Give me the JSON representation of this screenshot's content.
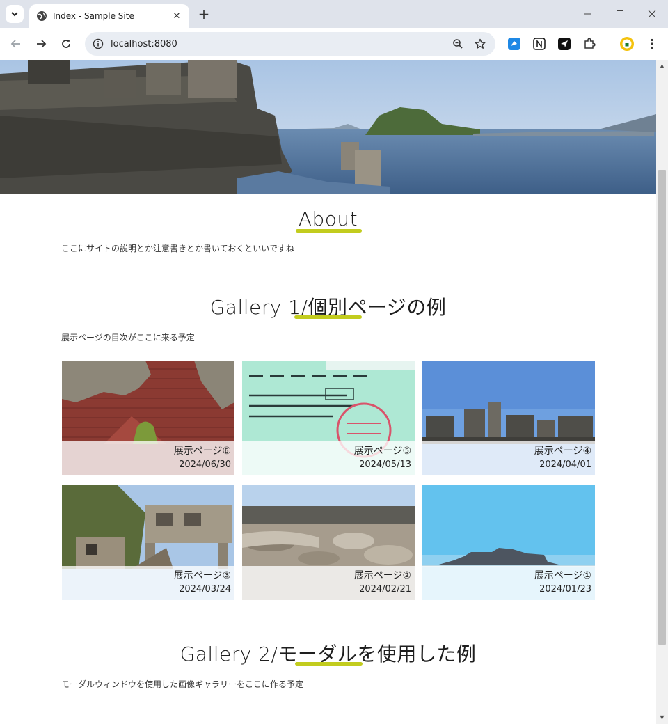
{
  "browser": {
    "tab_title": "Index - Sample Site",
    "url": "localhost:8080"
  },
  "about": {
    "title": "About",
    "text": "ここにサイトの説明とか注意書きとか書いておくといいですね"
  },
  "gallery1": {
    "title": "Gallery 1/個別ページの例",
    "text": "展示ページの目次がここに来る予定",
    "items": [
      {
        "title": "展示ページ⑥",
        "date": "2024/06/30"
      },
      {
        "title": "展示ページ⑤",
        "date": "2024/05/13"
      },
      {
        "title": "展示ページ④",
        "date": "2024/04/01"
      },
      {
        "title": "展示ページ③",
        "date": "2024/03/24"
      },
      {
        "title": "展示ページ②",
        "date": "2024/02/21"
      },
      {
        "title": "展示ページ①",
        "date": "2024/01/23"
      }
    ]
  },
  "gallery2": {
    "title": "Gallery 2/モーダルを使用した例",
    "text": "モーダルウィンドウを使用した画像ギャラリーをここに作る予定"
  },
  "colors": {
    "accent_underline": "#c2cc1e",
    "chrome_bg": "#dfe3eb"
  }
}
